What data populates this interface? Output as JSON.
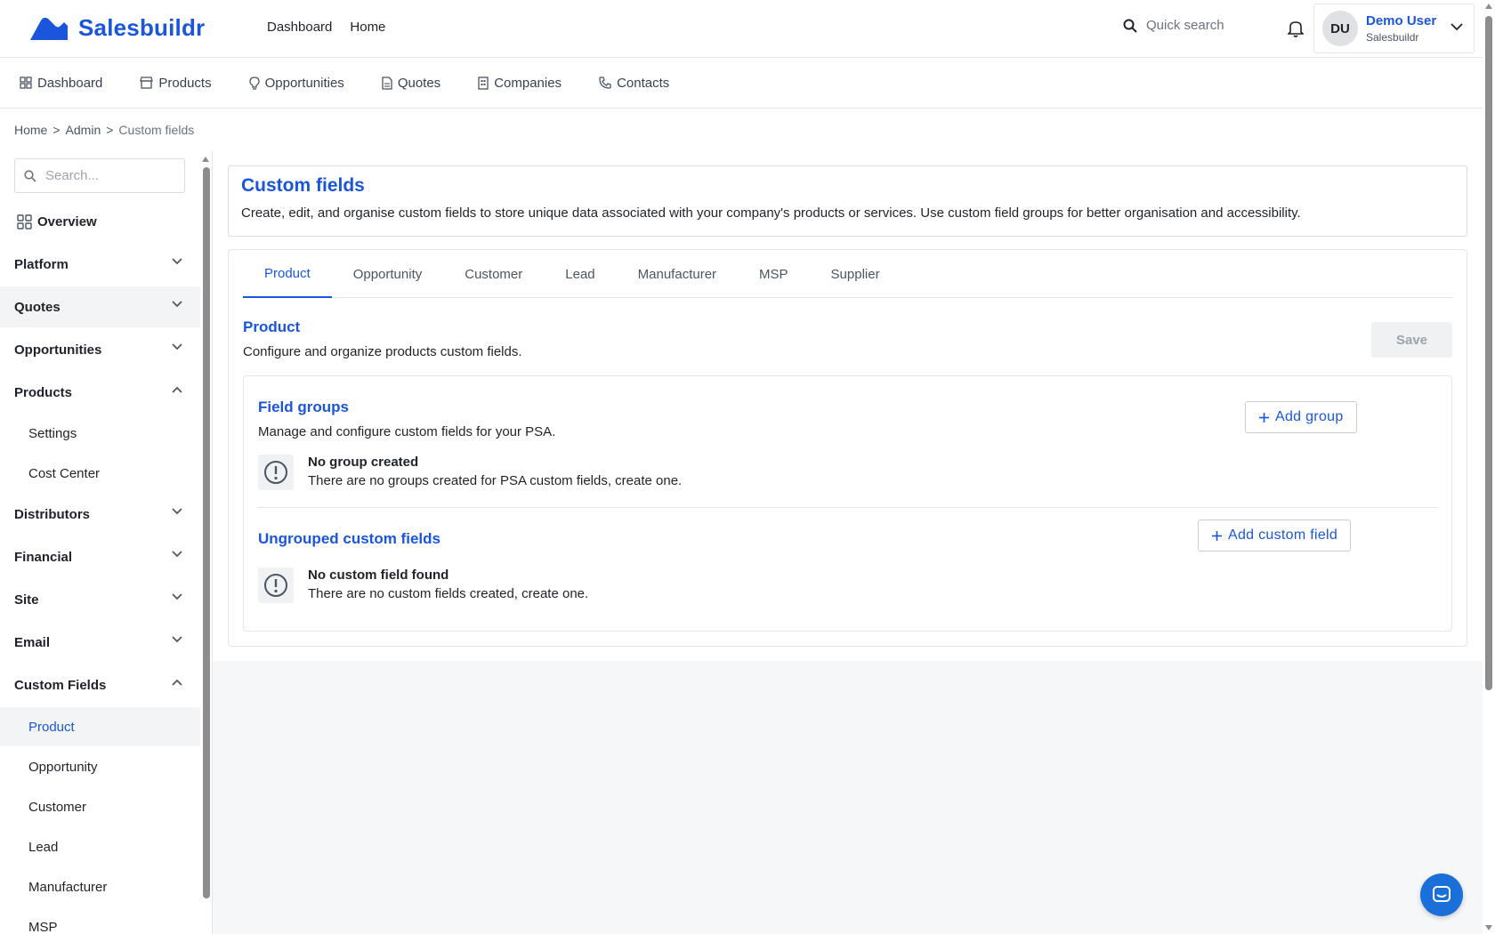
{
  "app": {
    "brand": "Salesbuildr",
    "top_nav": [
      "Dashboard",
      "Home"
    ],
    "quick_search_placeholder": "Quick search",
    "user": {
      "initials": "DU",
      "name": "Demo User",
      "org": "Salesbuildr"
    }
  },
  "subnav": [
    {
      "label": "Dashboard",
      "icon": "grid-icon"
    },
    {
      "label": "Products",
      "icon": "storefront-icon"
    },
    {
      "label": "Opportunities",
      "icon": "lightbulb-icon"
    },
    {
      "label": "Quotes",
      "icon": "document-icon"
    },
    {
      "label": "Companies",
      "icon": "building-icon"
    },
    {
      "label": "Contacts",
      "icon": "phone-icon"
    }
  ],
  "breadcrumb": {
    "home": "Home",
    "admin": "Admin",
    "current": "Custom fields",
    "separator": ">"
  },
  "sidebar": {
    "search_placeholder": "Search...",
    "overview": "Overview",
    "platform": "Platform",
    "quotes": "Quotes",
    "opportunities": "Opportunities",
    "products": "Products",
    "products_settings": "Settings",
    "products_cost_center": "Cost Center",
    "distributors": "Distributors",
    "financial": "Financial",
    "site": "Site",
    "email": "Email",
    "custom_fields": "Custom Fields",
    "cf_product": "Product",
    "cf_opportunity": "Opportunity",
    "cf_customer": "Customer",
    "cf_lead": "Lead",
    "cf_manufacturer": "Manufacturer",
    "cf_msp": "MSP"
  },
  "header": {
    "title": "Custom fields",
    "description": "Create, edit, and organise custom fields to store unique data associated with your company's products or services. Use custom field groups for better organisation and accessibility."
  },
  "tabs": [
    "Product",
    "Opportunity",
    "Customer",
    "Lead",
    "Manufacturer",
    "MSP",
    "Supplier"
  ],
  "active_tab": "Product",
  "section": {
    "title": "Product",
    "description": "Configure and organize products custom fields.",
    "save_label": "Save"
  },
  "field_groups": {
    "title": "Field groups",
    "description": "Manage and configure custom fields for your PSA.",
    "add_label": "Add group",
    "empty_title": "No group created",
    "empty_desc": "There are no groups created for PSA custom fields, create one."
  },
  "ungrouped": {
    "title": "Ungrouped custom fields",
    "add_label": "Add custom field",
    "empty_title": "No custom field found",
    "empty_desc": "There are no custom fields created, create one."
  },
  "colors": {
    "accent": "#1a56db",
    "border": "#e3e5e8",
    "muted_bg": "#f3f4f6"
  }
}
